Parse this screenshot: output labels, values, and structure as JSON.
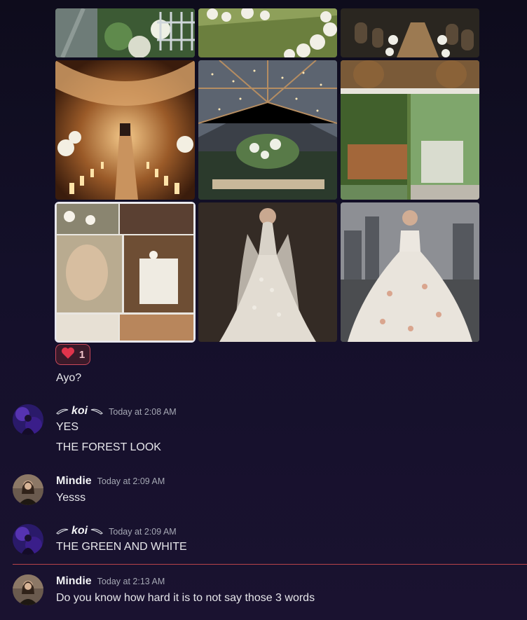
{
  "gallery": {
    "tiles": [
      {
        "name": "aisle-chairs-image"
      },
      {
        "name": "flower-lawn-image"
      },
      {
        "name": "chapel-aisle-image"
      },
      {
        "name": "candle-forest-aisle-image"
      },
      {
        "name": "clear-tent-reception-image"
      },
      {
        "name": "barrel-bar-image"
      },
      {
        "name": "boho-collage-image"
      },
      {
        "name": "lace-gown-image"
      },
      {
        "name": "rooftop-ballgown-image"
      }
    ]
  },
  "reaction": {
    "emoji": "heart-icon",
    "count": "1",
    "color": "#e0344c"
  },
  "messages": [
    {
      "text": "Ayo?"
    },
    {
      "author": "koi",
      "time": "Today at 2:08 AM",
      "lines": [
        "YES",
        "THE FOREST LOOK"
      ],
      "avatar": "koi-avatar"
    },
    {
      "author": "Mindie",
      "time": "Today at 2:09 AM",
      "lines": [
        "Yesss"
      ],
      "avatar": "mindie-avatar"
    },
    {
      "author": "koi",
      "time": "Today at 2:09 AM",
      "lines": [
        "THE GREEN AND WHITE"
      ],
      "avatar": "koi-avatar"
    },
    {
      "author": "Mindie",
      "time": "Today at 2:13 AM",
      "lines": [
        "Do you know how hard it is to not say those 3 words"
      ],
      "avatar": "mindie-avatar"
    }
  ],
  "colors": {
    "new_messages_divider": "#b8434a",
    "background": "#14102a"
  }
}
